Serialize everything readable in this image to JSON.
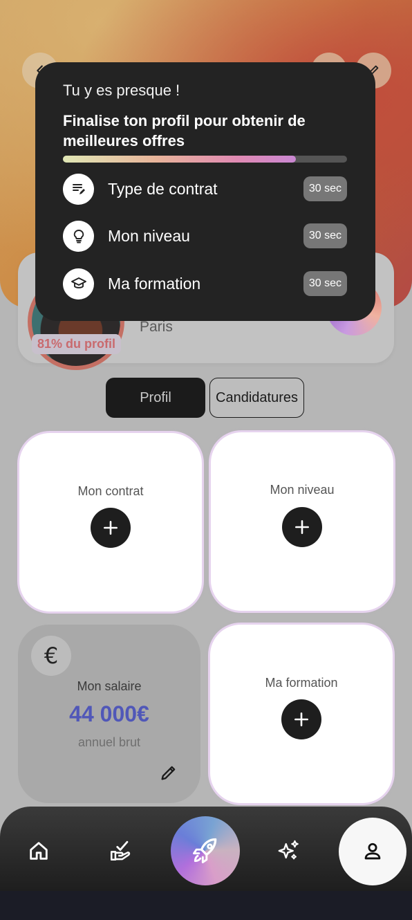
{
  "popup": {
    "kicker": "Tu y es presque !",
    "title": "Finalise ton profil pour obtenir de meilleures offres",
    "progress": 0.82,
    "tasks": [
      {
        "label": "Type de contrat",
        "time": "30 sec",
        "icon": "contract-edit-icon"
      },
      {
        "label": "Mon niveau",
        "time": "30 sec",
        "icon": "lightbulb-icon"
      },
      {
        "label": "Ma formation",
        "time": "30 sec",
        "icon": "graduation-cap-icon"
      }
    ]
  },
  "profile": {
    "city": "Paris",
    "completion_badge": "81% du profil"
  },
  "tabs": {
    "profil": "Profil",
    "candidatures": "Candidatures"
  },
  "tiles": {
    "contrat": {
      "label": "Mon contrat"
    },
    "niveau": {
      "label": "Mon niveau"
    },
    "formation": {
      "label": "Ma formation"
    },
    "salaire": {
      "label": "Mon salaire",
      "value": "44 000€",
      "sub": "annuel brut",
      "currency_symbol": "€"
    }
  },
  "colors": {
    "salary_value": "#5057b8",
    "badge_text": "#c96a6e",
    "popup_bg": "#232323"
  },
  "nav": {
    "items": [
      "home-icon",
      "applications-icon",
      "rocket-icon",
      "sparkles-icon",
      "profile-icon"
    ]
  }
}
